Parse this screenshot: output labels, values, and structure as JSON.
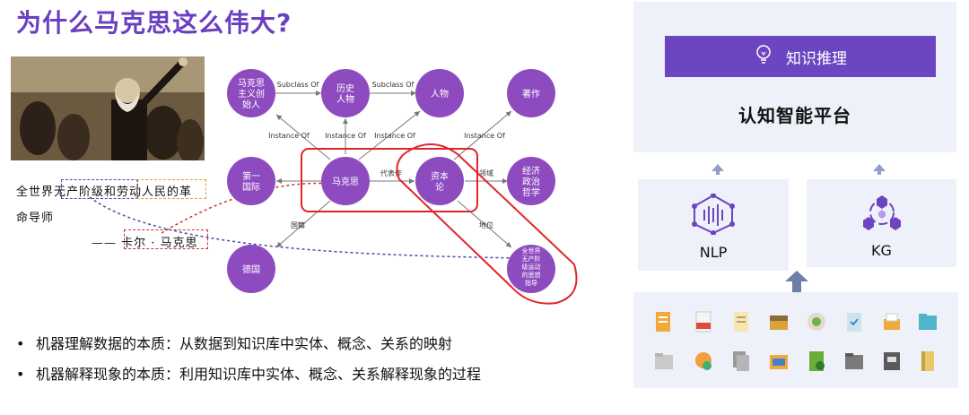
{
  "title": "为什么马克思这么伟大?",
  "quote": {
    "line1": "全世界无产阶级和劳动人民的革",
    "line2": "命导师",
    "author": "—— 卡尔 · 马克思"
  },
  "graph": {
    "nodes": {
      "founder": "马克思主义创始人",
      "historical": "历史人物",
      "person": "人物",
      "work": "著作",
      "first_intl": "第一国际",
      "marx": "马克思",
      "capital": "资本论",
      "economics": "经济政治哲学",
      "germany": "德国",
      "guiding": "全世界无产阶级运动的思想指导"
    },
    "edges": {
      "subclass1": "Subclass Of",
      "subclass2": "Subclass Of",
      "instance1": "Instance Of",
      "instance2": "Instance Of",
      "instance3": "Instance Of",
      "instance4": "Instance Of",
      "representative": "代表作",
      "field": "领域",
      "nationality": "国籍",
      "status": "地位"
    }
  },
  "bullets": [
    "机器理解数据的本质：从数据到知识库中实体、概念、关系的映射",
    "机器解释现象的本质：利用知识库中实体、概念、关系解释现象的过程"
  ],
  "platform": {
    "reasoning_label": "知识推理",
    "title": "认知智能平台",
    "nlp_label": "NLP",
    "kg_label": "KG"
  },
  "colors": {
    "purple": "#6c45c1",
    "node": "#8e4bc0",
    "panel": "#eef1f9",
    "highlight_red": "#e0262b"
  },
  "icons": [
    "lightbulb-icon",
    "nlp-network-icon",
    "kg-graph-icon",
    "arrow-up-icon",
    "document-icon",
    "folder-icon"
  ]
}
